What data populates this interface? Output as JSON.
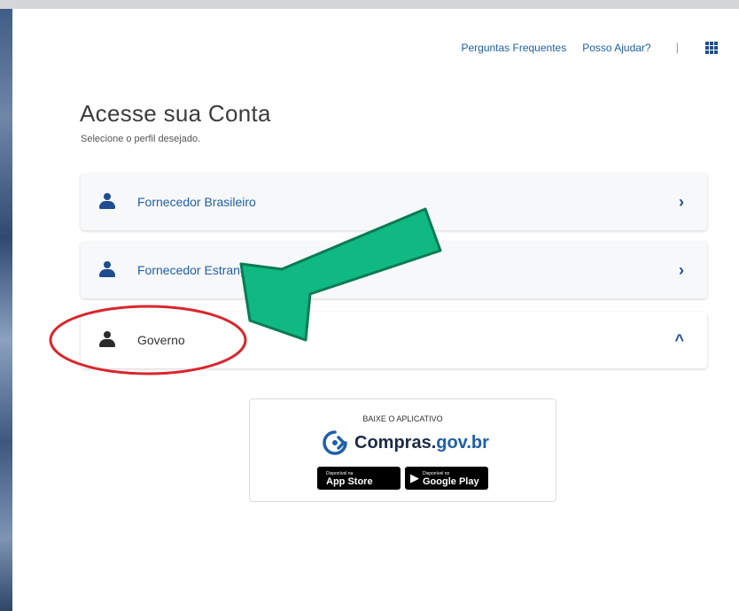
{
  "header": {
    "links": [
      "Perguntas Frequentes",
      "Posso Ajudar?"
    ],
    "separator": "|"
  },
  "page": {
    "title": "Acesse sua Conta",
    "subtitle": "Selecione o perfil desejado."
  },
  "profiles": [
    {
      "label": "Fornecedor Brasileiro",
      "chevron": "›",
      "icon": "user-group-icon"
    },
    {
      "label": "Fornecedor Estrangeiro",
      "chevron": "›",
      "icon": "user-group-icon"
    },
    {
      "label": "Governo",
      "chevron": "^",
      "icon": "user-icon"
    }
  ],
  "app": {
    "caption": "BAIXE O APLICATIVO",
    "brand_main": "Compras.",
    "brand_sub": "gov.br",
    "app_store_small": "Disponível na",
    "app_store": "App Store",
    "google_play_small": "Disponível no",
    "google_play": "Google Play"
  },
  "colors": {
    "link": "#1f5fa8",
    "icon": "#1f4d8f",
    "arrow": "#10b981",
    "circle": "#d9262c"
  }
}
